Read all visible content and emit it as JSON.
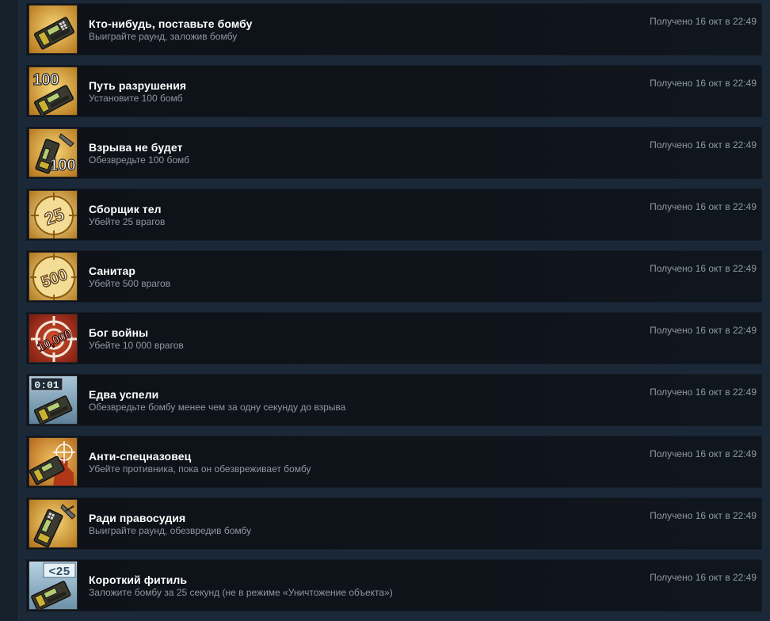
{
  "achievements": [
    {
      "title": "Кто-нибудь, поставьте бомбу",
      "description": "Выиграйте раунд, заложив бомбу",
      "unlocked": "Получено 16 окт в 22:49",
      "icon": "bomb-plant-icon",
      "badge": ""
    },
    {
      "title": "Путь разрушения",
      "description": "Установите 100 бомб",
      "unlocked": "Получено 16 окт в 22:49",
      "icon": "bomb-100-planted-icon",
      "badge": "100"
    },
    {
      "title": "Взрыва не будет",
      "description": "Обезвредьте 100 бомб",
      "unlocked": "Получено 16 окт в 22:49",
      "icon": "bomb-100-defused-icon",
      "badge": "100"
    },
    {
      "title": "Сборщик тел",
      "description": "Убейте 25 врагов",
      "unlocked": "Получено 16 окт в 22:49",
      "icon": "target-25-icon",
      "badge": "25"
    },
    {
      "title": "Санитар",
      "description": "Убейте 500 врагов",
      "unlocked": "Получено 16 окт в 22:49",
      "icon": "target-500-icon",
      "badge": "500"
    },
    {
      "title": "Бог войны",
      "description": "Убейте 10 000 врагов",
      "unlocked": "Получено 16 окт в 22:49",
      "icon": "target-10000-icon",
      "badge": "10,000"
    },
    {
      "title": "Едва успели",
      "description": "Обезвредьте бомбу менее чем за одну секунду до взрыва",
      "unlocked": "Получено 16 окт в 22:49",
      "icon": "bomb-timer-icon",
      "badge": "0:01"
    },
    {
      "title": "Анти-спецназовец",
      "description": "Убейте противника, пока он обезвреживает бомбу",
      "unlocked": "Получено 16 окт в 22:49",
      "icon": "bomb-crosshair-icon",
      "badge": ""
    },
    {
      "title": "Ради правосудия",
      "description": "Выиграйте раунд, обезвредив бомбу",
      "unlocked": "Получено 16 окт в 22:49",
      "icon": "bomb-defuse-icon",
      "badge": ""
    },
    {
      "title": "Короткий фитиль",
      "description": "Заложите бомбу за 25 секунд (не в режиме «Уничтожение объекта»)",
      "unlocked": "Получено 16 окт в 22:49",
      "icon": "bomb-under-25-icon",
      "badge": "<25"
    }
  ],
  "colors": {
    "background": "#1b2838",
    "row": "#0f141b",
    "title": "#ffffff",
    "muted": "#8f98a0",
    "gold": "#e0b040",
    "red": "#a02018"
  }
}
